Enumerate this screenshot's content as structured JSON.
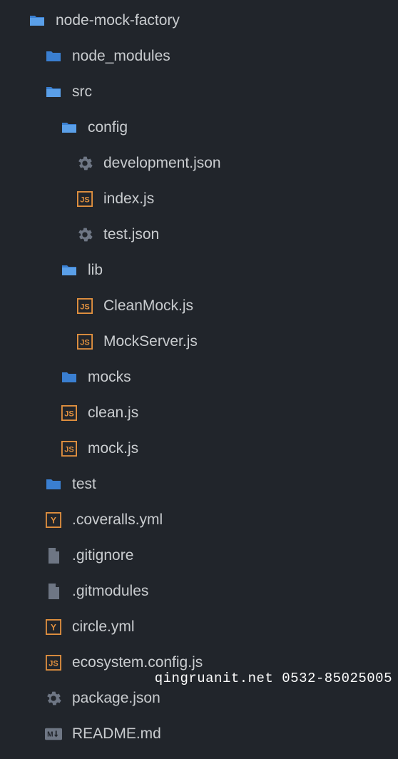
{
  "tree": [
    {
      "indent": 0,
      "icon": "folder-open-blue",
      "label": "node-mock-factory"
    },
    {
      "indent": 1,
      "icon": "folder-closed-blue",
      "label": "node_modules"
    },
    {
      "indent": 1,
      "icon": "folder-open-blue",
      "label": "src"
    },
    {
      "indent": 2,
      "icon": "folder-open-blue",
      "label": "config"
    },
    {
      "indent": 3,
      "icon": "gear",
      "label": "development.json"
    },
    {
      "indent": 3,
      "icon": "js",
      "label": "index.js"
    },
    {
      "indent": 3,
      "icon": "gear",
      "label": "test.json"
    },
    {
      "indent": 2,
      "icon": "folder-open-blue",
      "label": "lib"
    },
    {
      "indent": 3,
      "icon": "js",
      "label": "CleanMock.js"
    },
    {
      "indent": 3,
      "icon": "js",
      "label": "MockServer.js"
    },
    {
      "indent": 2,
      "icon": "folder-closed-blue",
      "label": "mocks"
    },
    {
      "indent": 2,
      "icon": "js",
      "label": "clean.js"
    },
    {
      "indent": 2,
      "icon": "js",
      "label": "mock.js"
    },
    {
      "indent": 1,
      "icon": "folder-closed-blue",
      "label": "test"
    },
    {
      "indent": 1,
      "icon": "yml",
      "label": ".coveralls.yml"
    },
    {
      "indent": 1,
      "icon": "file",
      "label": ".gitignore"
    },
    {
      "indent": 1,
      "icon": "file",
      "label": ".gitmodules"
    },
    {
      "indent": 1,
      "icon": "yml",
      "label": "circle.yml"
    },
    {
      "indent": 1,
      "icon": "js",
      "label": "ecosystem.config.js"
    },
    {
      "indent": 1,
      "icon": "gear",
      "label": "package.json"
    },
    {
      "indent": 1,
      "icon": "md",
      "label": "README.md"
    }
  ],
  "watermark": "qingruanit.net 0532-85025005"
}
